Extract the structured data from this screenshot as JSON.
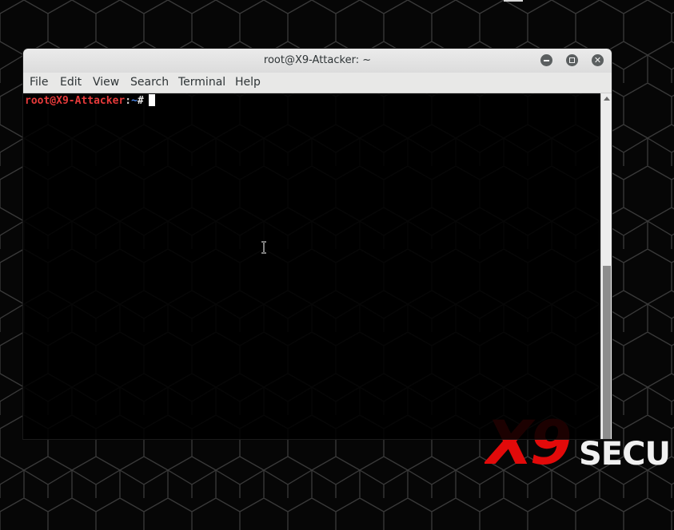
{
  "window": {
    "title": "root@X9-Attacker: ~",
    "minimize_icon": "minimize-icon",
    "maximize_icon": "maximize-icon",
    "close_icon": "close-icon"
  },
  "menu": {
    "items": [
      {
        "label": "File"
      },
      {
        "label": "Edit"
      },
      {
        "label": "View"
      },
      {
        "label": "Search"
      },
      {
        "label": "Terminal"
      },
      {
        "label": "Help"
      }
    ]
  },
  "terminal": {
    "prompt_user_host": "root@X9-Attacker",
    "prompt_colon": ":",
    "prompt_path": "~",
    "prompt_symbol": "#",
    "scroll_position_fraction": 1.0
  },
  "desktop": {
    "logo_x9": "X9",
    "logo_text": "SECU"
  },
  "colors": {
    "prompt_user": "#e63a3a",
    "prompt_path": "#4a86e8",
    "logo_red": "#e20a0a",
    "titlebar": "#e8e8e7"
  }
}
